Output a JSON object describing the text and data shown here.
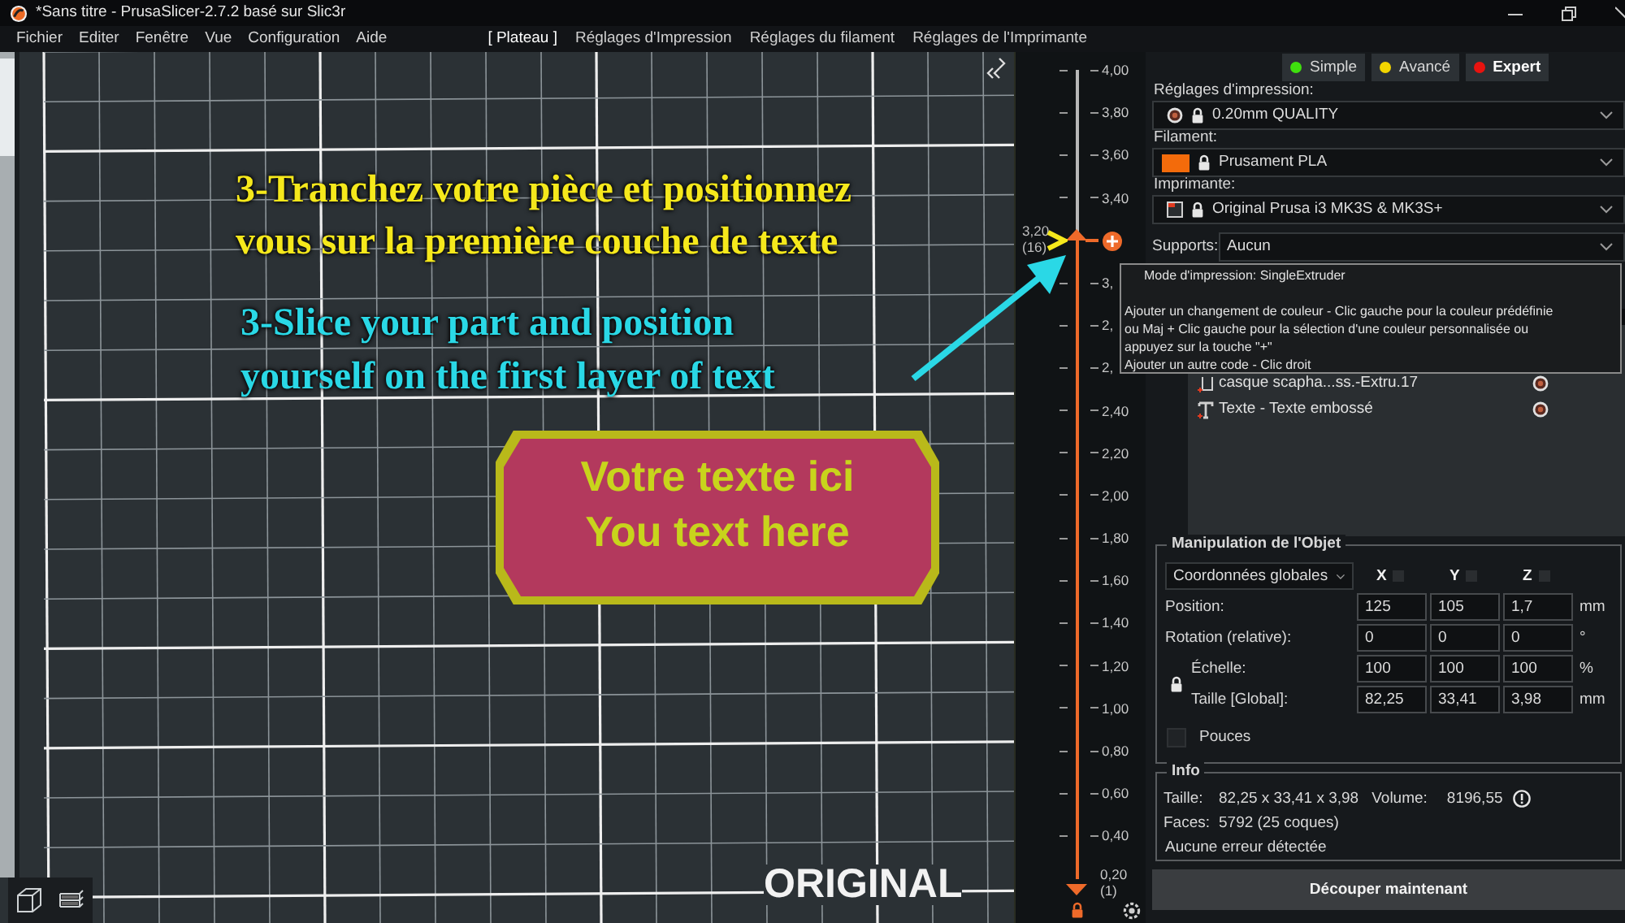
{
  "window": {
    "title": "*Sans titre - PrusaSlicer-2.7.2 basé sur Slic3r"
  },
  "menu": [
    "Fichier",
    "Editer",
    "Fenêtre",
    "Vue",
    "Configuration",
    "Aide"
  ],
  "tabs": [
    {
      "label": "[ Plateau ]",
      "selected": true
    },
    {
      "label": "Réglages d'Impression",
      "selected": false
    },
    {
      "label": "Réglages du filament",
      "selected": false
    },
    {
      "label": "Réglages de l'Imprimante",
      "selected": false
    }
  ],
  "viewport": {
    "model_lines": [
      "Votre texte ici",
      "You text here"
    ],
    "bed_label": "ORIGINAL"
  },
  "annotations": [
    {
      "color": "#f5e81c",
      "lines": [
        "3-Tranchez votre pièce et positionnez",
        "vous sur la première couche de texte"
      ]
    },
    {
      "color": "#2ad8e6",
      "lines": [
        "3-Slice your part and position",
        "yourself on the first layer of text"
      ]
    }
  ],
  "layer_slider": {
    "ticks": [
      {
        "label": "4,00"
      },
      {
        "label": "3,80"
      },
      {
        "label": "3,60"
      },
      {
        "label": "3,40"
      },
      {
        "kind": "thumb"
      },
      {
        "label": "3,"
      },
      {
        "label": "2,"
      },
      {
        "label": "2,"
      },
      {
        "label": "2,40"
      },
      {
        "label": "2,20"
      },
      {
        "label": "2,00"
      },
      {
        "label": "1,80"
      },
      {
        "label": "1,60"
      },
      {
        "label": "1,40"
      },
      {
        "label": "1,20"
      },
      {
        "label": "1,00"
      },
      {
        "label": "0,80"
      },
      {
        "label": "0,60"
      },
      {
        "label": "0,40"
      }
    ],
    "level": 0.789,
    "thumb_value": "3,20",
    "thumb_layer": "(16)",
    "bottom_value": "0,20",
    "bottom_layer": "(1)"
  },
  "modes": [
    {
      "label": "Simple",
      "color": "#3fe00e",
      "selected": false
    },
    {
      "label": "Avancé",
      "color": "#f2d500",
      "selected": false
    },
    {
      "label": "Expert",
      "color": "#e8130f",
      "selected": true
    }
  ],
  "presets": [
    {
      "kind": "print",
      "label": "Réglages d'impression:",
      "value": "0.20mm QUALITY"
    },
    {
      "kind": "filament",
      "label": "Filament:",
      "value": "Prusament PLA",
      "color": "#f36b0b"
    },
    {
      "kind": "printer",
      "label": "Imprimante:",
      "value": "Original Prusa i3 MK3S & MK3S+"
    }
  ],
  "supports": {
    "label": "Supports:",
    "value": "Aucun"
  },
  "tooltip": {
    "title": "Mode d'impression: SingleExtruder",
    "lines": [
      "Ajouter un changement de couleur - Clic gauche pour la couleur prédéfinie",
      "ou Maj + Clic gauche pour la sélection d'une couleur personnalisée ou",
      "appuyez sur la touche \"+\"",
      "Ajouter un autre code - Clic droit"
    ]
  },
  "objects": [
    {
      "kind": "part",
      "name": "casque scapha...ss.-Extru.17"
    },
    {
      "kind": "text",
      "name": "Texte - Texte embossé"
    }
  ],
  "manipulation": {
    "title": "Manipulation de l'Objet",
    "coordinates": "Coordonnées globales",
    "axes": [
      "X",
      "Y",
      "Z"
    ],
    "rows": [
      {
        "kind": "plain",
        "label": "Position:",
        "values": [
          "125",
          "105",
          "1,7"
        ],
        "unit": "mm"
      },
      {
        "kind": "plain",
        "label": "Rotation (relative):",
        "values": [
          "0",
          "0",
          "0"
        ],
        "unit": "°"
      },
      {
        "kind": "linked",
        "label": "Échelle:",
        "values": [
          "100",
          "100",
          "100"
        ],
        "unit": "%"
      },
      {
        "kind": "linked",
        "label": "Taille [Global]:",
        "values": [
          "82,25",
          "33,41",
          "3,98"
        ],
        "unit": "mm"
      }
    ],
    "inches": {
      "label": "Pouces",
      "checked": false
    }
  },
  "info": {
    "title": "Info",
    "size_label": "Taille:",
    "size": "82,25 x 33,41 x 3,98",
    "volume_label": "Volume:",
    "volume": "8196,55",
    "faces_label": "Faces:",
    "faces": "5792 (25 coques)",
    "status": "Aucune erreur détectée"
  },
  "slice_button": "Découper maintenant"
}
